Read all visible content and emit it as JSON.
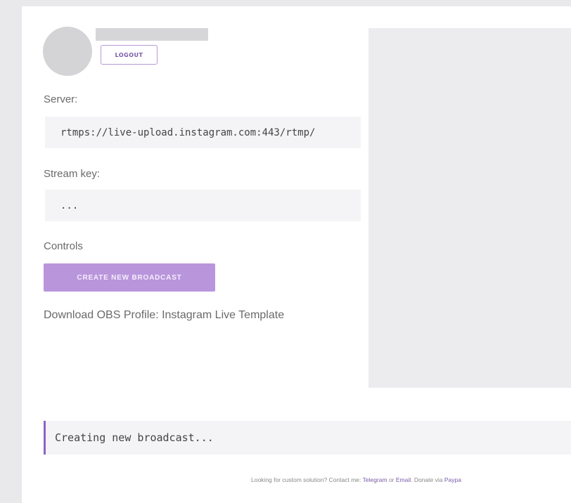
{
  "profile": {
    "logout_label": "LOGOUT"
  },
  "server": {
    "label": "Server:",
    "value": "rtmps://live-upload.instagram.com:443/rtmp/"
  },
  "stream_key": {
    "label": "Stream key:",
    "value": "..."
  },
  "controls": {
    "label": "Controls",
    "create_button": "CREATE NEW BROADCAST"
  },
  "obs_profile": {
    "link_text": "Download OBS Profile: Instagram Live Template"
  },
  "log": {
    "message": "Creating new broadcast..."
  },
  "footer": {
    "text_before": "Looking for custom solution? Contact me: ",
    "telegram_link": "Telegram",
    "or_text": " or ",
    "email_link": "Email",
    "donate_text": ". Donate via ",
    "paypal_link": "Paypa"
  },
  "colors": {
    "accent": "#b995dc",
    "accent_dark": "#8c64c8",
    "page_background": "#e9e9ec"
  }
}
